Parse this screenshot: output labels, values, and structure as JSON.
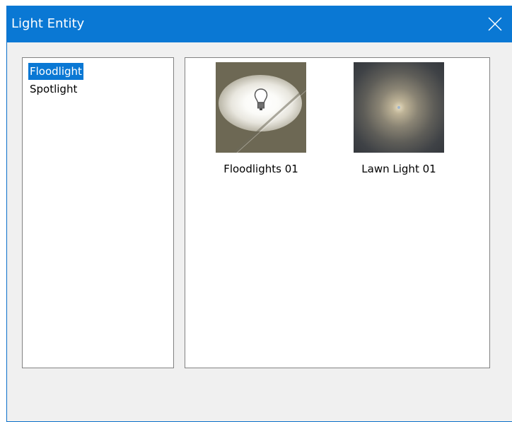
{
  "window": {
    "title": "Light Entity",
    "accent_color": "#0a78d4"
  },
  "title_bar": {
    "close_icon": "close-icon"
  },
  "categories": {
    "items": [
      {
        "label": "Floodlight",
        "selected": true
      },
      {
        "label": "Spotlight",
        "selected": false
      }
    ]
  },
  "gallery": {
    "items": [
      {
        "label": "Floodlights 01",
        "thumbnail_icon": "floodlight-thumbnail"
      },
      {
        "label": "Lawn Light 01",
        "thumbnail_icon": "lawn-light-thumbnail"
      }
    ]
  }
}
